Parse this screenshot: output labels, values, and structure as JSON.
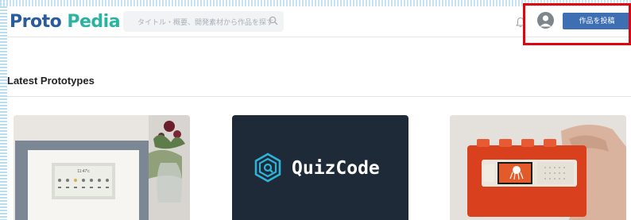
{
  "header": {
    "logo_part1": "Proto ",
    "logo_part2": "Pedia",
    "search_placeholder": "タイトル・概要、開発素材から作品を探す",
    "post_button_label": "作品を投稿"
  },
  "main": {
    "section_title": "Latest Prototypes",
    "cards": [
      {
        "image": "photo-frame-display"
      },
      {
        "image": "quizcode-logo",
        "logo_text": "QuizCode"
      },
      {
        "image": "lego-device-in-hand"
      }
    ]
  },
  "colors": {
    "brand_blue": "#2a5c9c",
    "brand_teal": "#2bb3a2",
    "button_blue": "#3f6fb3",
    "highlight_red": "#e0060e",
    "quiz_bg": "#1e2a38",
    "quiz_accent": "#2fb2d8"
  }
}
